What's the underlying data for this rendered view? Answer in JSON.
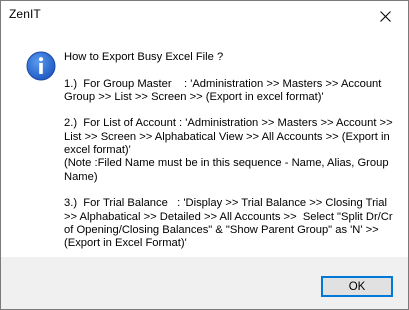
{
  "window": {
    "title": "ZenIT"
  },
  "message": {
    "question": "How to Export Busy Excel File ?",
    "step1": "1.)  For Group Master    : 'Administration >> Masters >> Account Group >> List >> Screen >> (Export in excel format)'",
    "step2": "2.)  For List of Account : 'Administration >> Masters >> Account >> List >> Screen >> Alphabatical View >> All Accounts >> (Export in excel format)'\n(Note :Filed Name must be in this sequence - Name, Alias, Group Name)",
    "step3": "3.)  For Trial Balance   : 'Display >> Trial Balance >> Closing Trial >> Alphabatical >> Detailed >> All Accounts >>  Select \"Split Dr/Cr of Opening/Closing Balances\" & \"Show Parent Group\" as 'N' >> (Export in Excel Format)'"
  },
  "buttons": {
    "ok_label": "OK"
  },
  "icons": {
    "message_icon": "info-icon",
    "close_icon": "close-icon"
  },
  "colors": {
    "accent": "#0078d7",
    "info_icon_fill": "#1e62c8",
    "footer_bg": "#f0f0f0"
  }
}
